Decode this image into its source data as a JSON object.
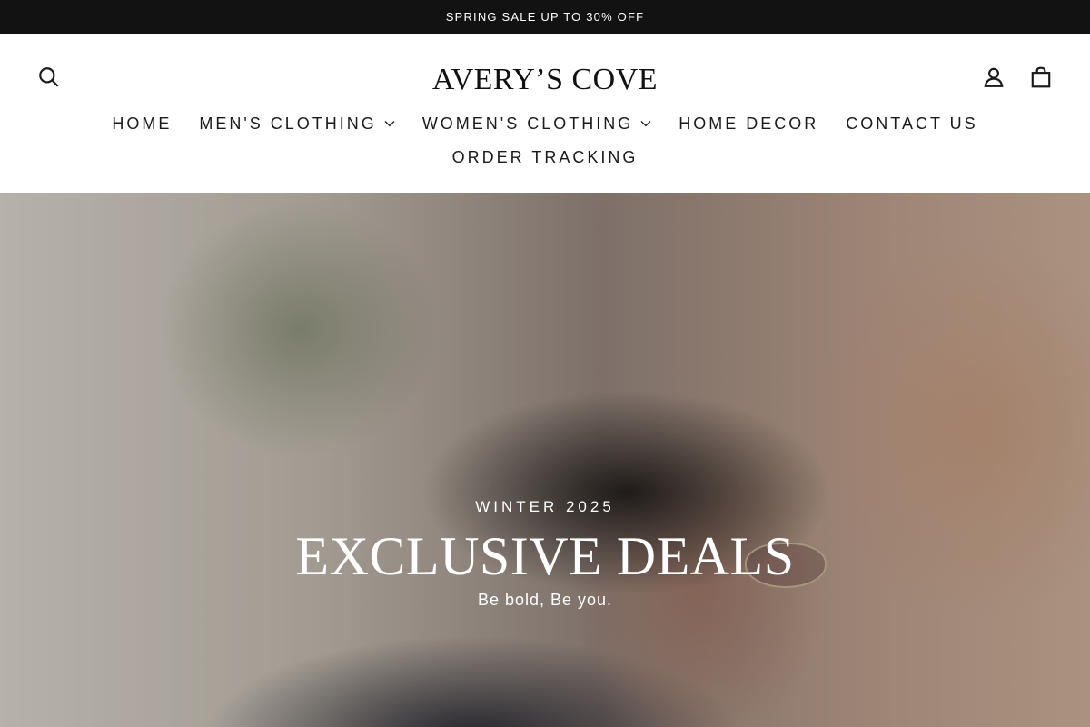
{
  "announcement": {
    "text": "SPRING SALE UP TO 30% OFF"
  },
  "header": {
    "logo_text": "AVERY’S COVE",
    "icons": {
      "search": "search-icon",
      "account": "user-icon",
      "cart": "bag-icon"
    }
  },
  "nav": {
    "items": [
      {
        "label": "HOME",
        "has_dropdown": false
      },
      {
        "label": "MEN'S CLOTHING",
        "has_dropdown": true
      },
      {
        "label": "WOMEN'S CLOTHING",
        "has_dropdown": true
      },
      {
        "label": "HOME DECOR",
        "has_dropdown": false
      },
      {
        "label": "CONTACT US",
        "has_dropdown": false
      },
      {
        "label": "ORDER TRACKING",
        "has_dropdown": false
      }
    ]
  },
  "hero": {
    "eyebrow": "WINTER 2025",
    "title": "EXCLUSIVE DEALS",
    "subtitle": "Be bold, Be you."
  },
  "colors": {
    "announcement_bg": "#121212",
    "announcement_text": "#ffffff",
    "header_bg": "#ffffff",
    "text_primary": "#1a1a1a",
    "hero_text": "#ffffff"
  }
}
